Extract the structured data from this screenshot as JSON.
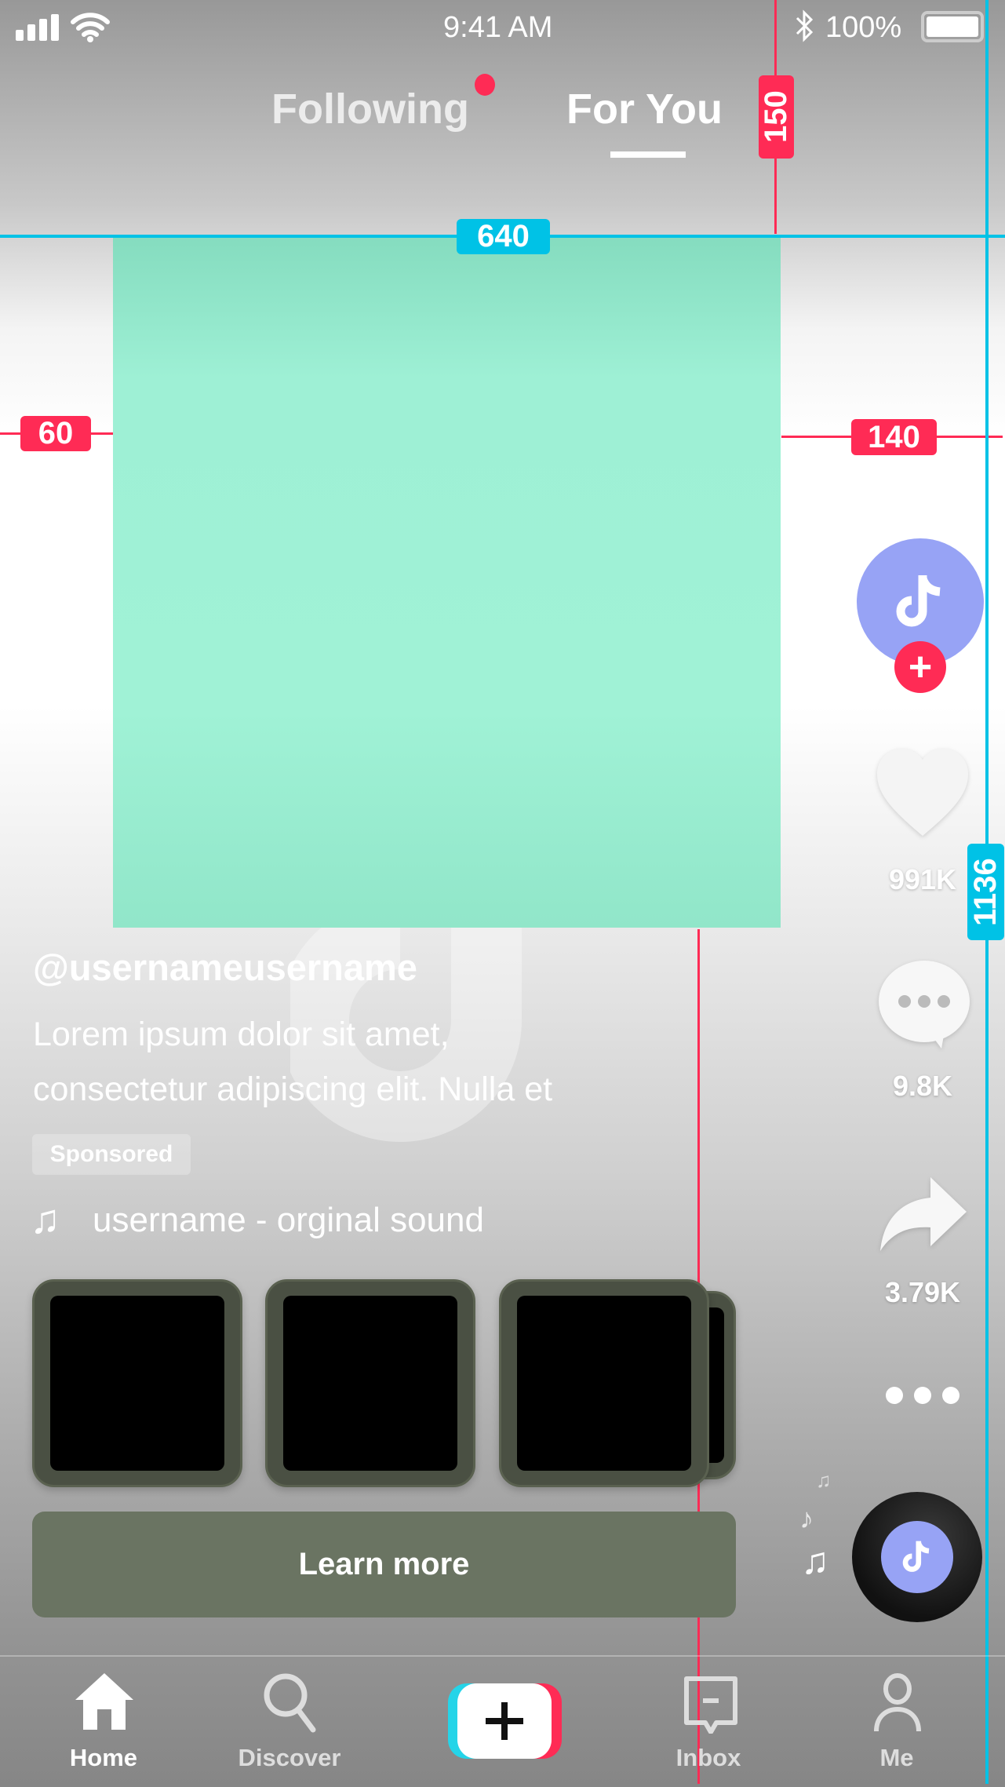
{
  "status_bar": {
    "time": "9:41 AM",
    "battery": "100%",
    "icons": [
      "signal-icon",
      "wifi-icon",
      "bluetooth-icon",
      "battery-icon"
    ]
  },
  "header": {
    "tabs": [
      {
        "label": "Following",
        "active": false,
        "has_notification_dot": true
      },
      {
        "label": "For You",
        "active": true
      }
    ]
  },
  "annotations": {
    "video_width": "640",
    "top_offset": "150",
    "left_margin": "60",
    "right_margin": "140",
    "screen_height": "1136",
    "bottom_height": "546"
  },
  "post": {
    "username": "@usernameusername",
    "description_lines": [
      "Lorem ipsum dolor sit amet,",
      "consectetur adipiscing elit. Nulla et"
    ],
    "badge": "Sponsored",
    "sound": "username - orginal sound",
    "cta": "Learn more"
  },
  "actions": {
    "likes": "991K",
    "comments": "9.8K",
    "shares": "3.79K"
  },
  "nav": {
    "items": [
      {
        "label": "Home",
        "active": true
      },
      {
        "label": "Discover"
      },
      {
        "label": ""
      },
      {
        "label": "Inbox"
      },
      {
        "label": "Me"
      }
    ]
  },
  "colors": {
    "accent_red": "#ff2b55",
    "annotation_cyan": "#00c2e6",
    "video_placeholder": "#9ef0d5",
    "avatar": "#97a3f5",
    "cta_button": "#6a7462"
  }
}
